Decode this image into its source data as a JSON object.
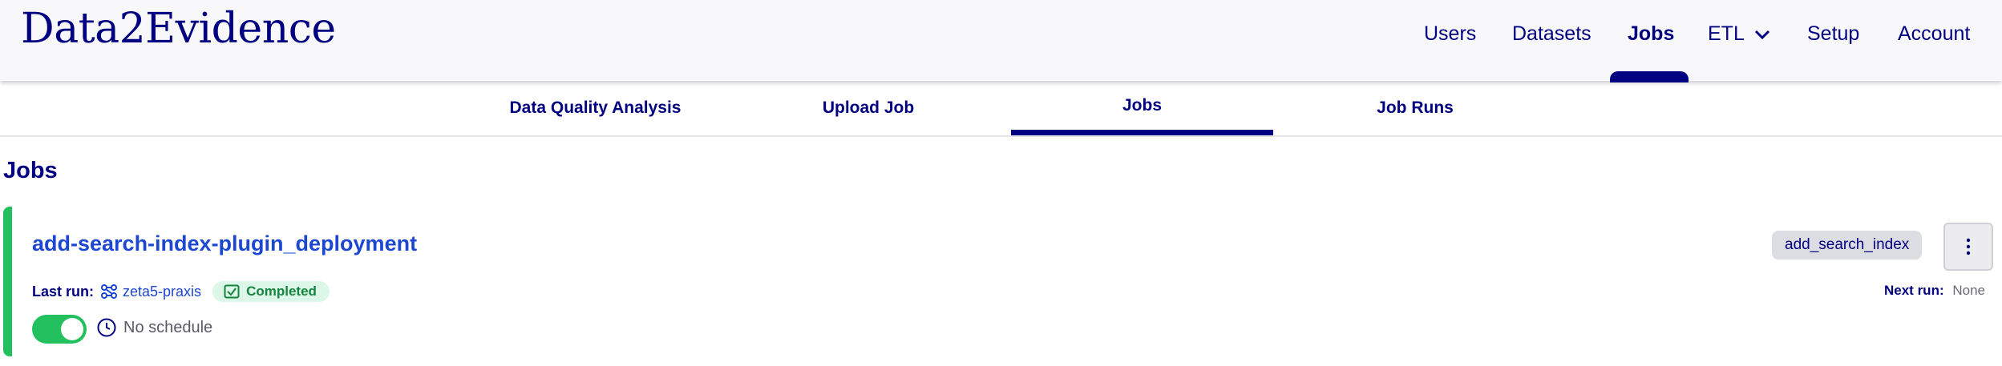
{
  "app": {
    "brand": "Data2Evidence"
  },
  "topnav": {
    "users": "Users",
    "datasets": "Datasets",
    "jobs": "Jobs",
    "etl": "ETL",
    "setup": "Setup",
    "account": "Account",
    "active": "Jobs"
  },
  "subnav": {
    "tabs": [
      "Data Quality Analysis",
      "Upload Job",
      "Jobs",
      "Job Runs"
    ],
    "active": "Jobs"
  },
  "page": {
    "title": "Jobs"
  },
  "job": {
    "name": "add-search-index-plugin_deployment",
    "last_run_label": "Last run:",
    "last_run_name": "zeta5-praxis",
    "status": "Completed",
    "schedule_enabled": true,
    "schedule_text": "No schedule",
    "tag": "add_search_index",
    "next_run_label": "Next run:",
    "next_run_value": "None"
  },
  "colors": {
    "brand_navy": "#000080",
    "link_blue": "#1d47d1",
    "success_green": "#22c15e",
    "status_badge_bg": "#dcf6e7",
    "status_badge_text": "#14853f"
  },
  "icons": {
    "etl_dropdown": "chevron-down-icon",
    "last_run": "flow-icon",
    "status": "check-square-icon",
    "schedule": "clock-icon",
    "menu": "kebab-menu-icon"
  }
}
